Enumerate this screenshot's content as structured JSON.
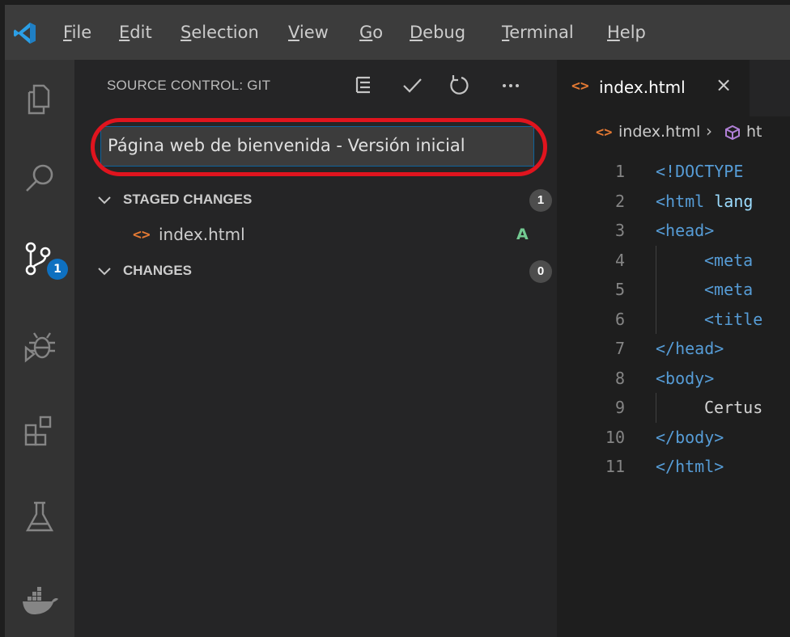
{
  "menu": [
    {
      "label": "File",
      "mnemonic": "F",
      "rest": "ile"
    },
    {
      "label": "Edit",
      "mnemonic": "E",
      "rest": "dit"
    },
    {
      "label": "Selection",
      "mnemonic": "S",
      "rest": "election"
    },
    {
      "label": "View",
      "mnemonic": "V",
      "rest": "iew"
    },
    {
      "label": "Go",
      "mnemonic": "G",
      "rest": "o"
    },
    {
      "label": "Debug",
      "mnemonic": "D",
      "rest": "ebug"
    },
    {
      "label": "Terminal",
      "mnemonic": "T",
      "rest": "erminal"
    },
    {
      "label": "Help",
      "mnemonic": "H",
      "rest": "elp"
    }
  ],
  "activity_bar": {
    "items": [
      "explorer-icon",
      "search-icon",
      "source-control-icon",
      "debug-icon",
      "extensions-icon",
      "testing-icon",
      "docker-icon"
    ],
    "source_control_badge": "1"
  },
  "sidebar": {
    "title": "SOURCE CONTROL: GIT",
    "actions": [
      "view-as-tree-icon",
      "commit-check-icon",
      "refresh-icon",
      "more-actions-icon"
    ],
    "commit_message": "Página web de bienvenida - Versión inicial",
    "staged": {
      "label": "STAGED CHANGES",
      "count": "1"
    },
    "staged_files": [
      {
        "icon": "<>",
        "name": "index.html",
        "status": "A"
      }
    ],
    "changes": {
      "label": "CHANGES",
      "count": "0"
    }
  },
  "editor": {
    "tab": {
      "icon": "<>",
      "label": "index.html",
      "close": "×"
    },
    "breadcrumb": {
      "icon": "<>",
      "file": "index.html",
      "separator": "›",
      "node": "ht"
    },
    "lines": [
      {
        "n": "1",
        "indent": 0,
        "parts": [
          {
            "c": "tag",
            "t": "<!DOCTYPE"
          }
        ]
      },
      {
        "n": "2",
        "indent": 0,
        "parts": [
          {
            "c": "tag",
            "t": "<html"
          },
          {
            "c": "attr",
            "t": " lang"
          }
        ]
      },
      {
        "n": "3",
        "indent": 0,
        "parts": [
          {
            "c": "tag",
            "t": "<head>"
          }
        ]
      },
      {
        "n": "4",
        "indent": 1,
        "parts": [
          {
            "c": "tag",
            "t": "<meta"
          }
        ]
      },
      {
        "n": "5",
        "indent": 1,
        "parts": [
          {
            "c": "tag",
            "t": "<meta"
          }
        ]
      },
      {
        "n": "6",
        "indent": 1,
        "parts": [
          {
            "c": "tag",
            "t": "<title"
          }
        ]
      },
      {
        "n": "7",
        "indent": 0,
        "parts": [
          {
            "c": "tag",
            "t": "</head>"
          }
        ]
      },
      {
        "n": "8",
        "indent": 0,
        "parts": [
          {
            "c": "tag",
            "t": "<body>"
          }
        ]
      },
      {
        "n": "9",
        "indent": 1,
        "parts": [
          {
            "c": "txt",
            "t": "Certus"
          }
        ]
      },
      {
        "n": "10",
        "indent": 0,
        "parts": [
          {
            "c": "tag",
            "t": "</body>"
          }
        ]
      },
      {
        "n": "11",
        "indent": 0,
        "parts": [
          {
            "c": "tag",
            "t": "</html>"
          }
        ]
      }
    ]
  },
  "colors": {
    "accent": "#0e70c0",
    "highlight_ring": "#e0141e",
    "added_status": "#73c991",
    "html_icon": "#e37933"
  }
}
